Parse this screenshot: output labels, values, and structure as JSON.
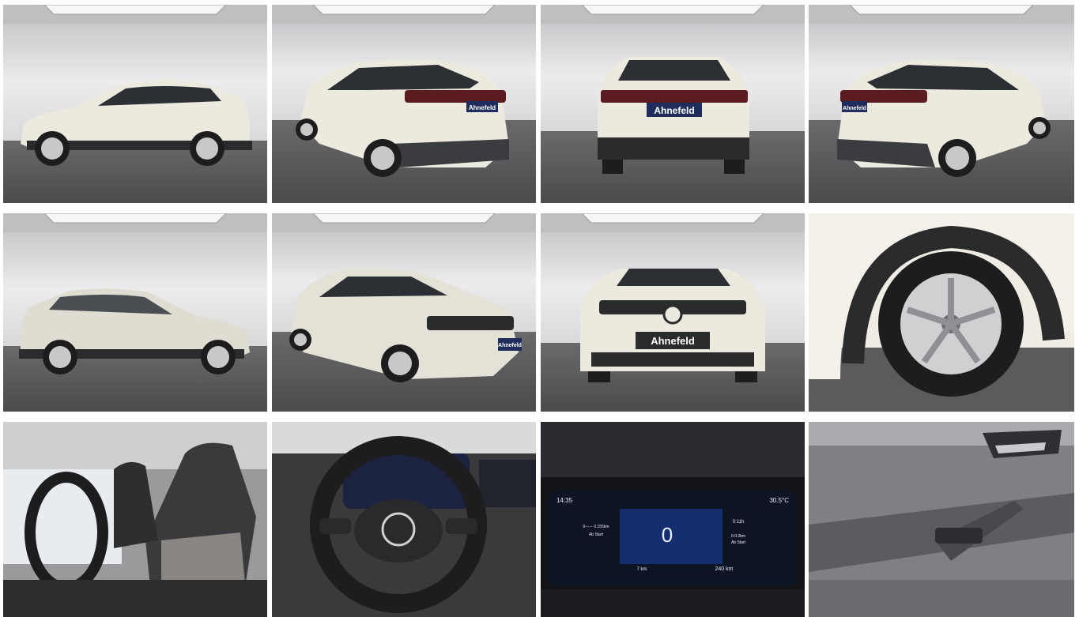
{
  "gallery": {
    "photos": [
      {
        "icon": "car-side-left-photo"
      },
      {
        "icon": "car-rear-three-quarter-left-photo"
      },
      {
        "icon": "car-rear-photo"
      },
      {
        "icon": "car-rear-three-quarter-right-photo"
      },
      {
        "icon": "car-side-right-photo"
      },
      {
        "icon": "car-front-three-quarter-photo"
      },
      {
        "icon": "car-front-photo"
      },
      {
        "icon": "wheel-closeup-photo"
      },
      {
        "icon": "front-seats-photo"
      },
      {
        "icon": "steering-wheel-photo"
      },
      {
        "icon": "instrument-cluster-photo"
      },
      {
        "icon": "door-panel-photo"
      }
    ],
    "plate_text": "Ahnefeld",
    "cluster": {
      "time": "14:35",
      "temp": "30.5°C",
      "speed": "0",
      "left_trip": "0---.-- 0.155km",
      "left_label": "Ab Start",
      "right_trip": "0:11h",
      "right_sub": "0-0.0km",
      "right_label": "Ab Start",
      "odometer": "7 km",
      "range": "240 km"
    },
    "colors": {
      "showroom_wall": "#e4e4e6",
      "showroom_floor": "#5e5e60",
      "car_body": "#ece9df",
      "trim": "#2a2b2d"
    }
  }
}
